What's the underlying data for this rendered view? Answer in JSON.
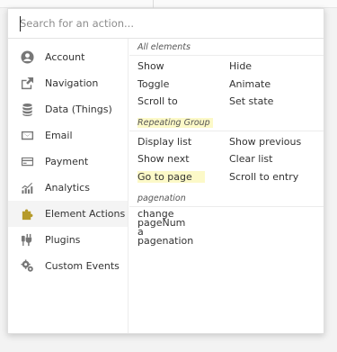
{
  "search": {
    "placeholder": "Search for an action..."
  },
  "sidebar": {
    "items": [
      {
        "label": "Account",
        "icon": "user-circle-icon"
      },
      {
        "label": "Navigation",
        "icon": "external-link-icon"
      },
      {
        "label": "Data (Things)",
        "icon": "database-icon"
      },
      {
        "label": "Email",
        "icon": "envelope-icon"
      },
      {
        "label": "Payment",
        "icon": "credit-card-icon"
      },
      {
        "label": "Analytics",
        "icon": "chart-icon"
      },
      {
        "label": "Element Actions",
        "icon": "puzzle-icon"
      },
      {
        "label": "Plugins",
        "icon": "plug-icon"
      },
      {
        "label": "Custom Events",
        "icon": "gears-icon"
      }
    ],
    "active_index": 6
  },
  "groups": {
    "all_elements": {
      "title": "All elements",
      "actions": [
        "Show",
        "Hide",
        "Toggle",
        "Animate",
        "Scroll to",
        "Set state"
      ]
    },
    "repeating_group": {
      "title": "Repeating Group",
      "actions": [
        "Display list",
        "Show previous",
        "Show next",
        "Clear list",
        "Go to page",
        "Scroll to entry"
      ]
    },
    "pagenation": {
      "title": "pagenation",
      "actions": [
        "change pageNum a pagenation"
      ]
    }
  },
  "colors": {
    "highlight": "#fcf9c8",
    "active_icon": "#b59a2a"
  }
}
